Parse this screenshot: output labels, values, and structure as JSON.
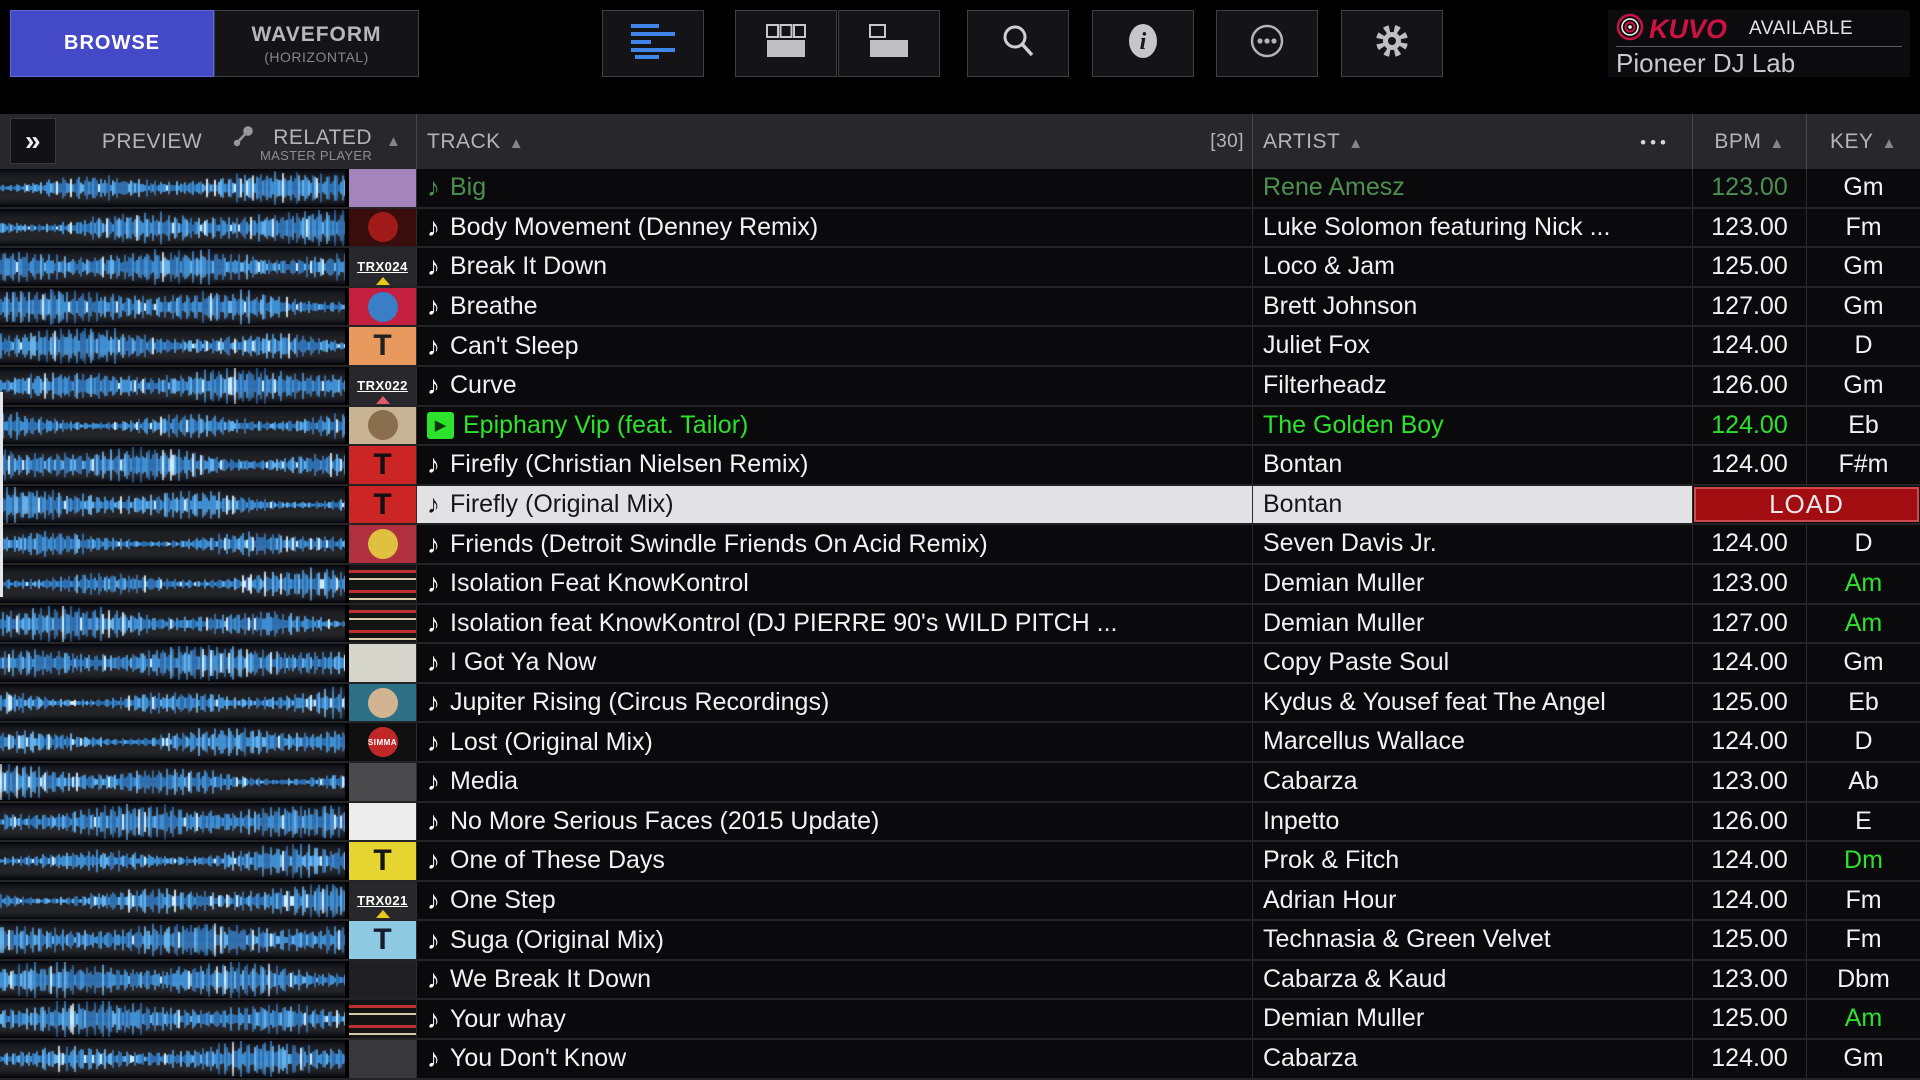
{
  "toolbar": {
    "browse_label": "BROWSE",
    "waveform_label": "WAVEFORM",
    "waveform_sublabel": "(HORIZONTAL)",
    "icons": [
      "list-view",
      "grid-3-view",
      "split-view",
      "search",
      "info",
      "more-options",
      "settings"
    ],
    "kuvo": {
      "brand": "KUVO",
      "status": "AVAILABLE",
      "device": "Pioneer DJ Lab",
      "brand_color": "#cc1244"
    }
  },
  "header": {
    "preview": "PREVIEW",
    "related": "RELATED",
    "related_sub": "MASTER PLAYER",
    "track": "TRACK",
    "track_count": "[30]",
    "artist": "ARTIST",
    "more": "•••",
    "bpm": "BPM",
    "key": "KEY"
  },
  "colors": {
    "accent_blue": "#4449c8",
    "playing_green": "#2ce22c",
    "related_green": "#4d8f50",
    "selected_row": "#e2e2e4",
    "load_red": "#a20d12",
    "waveform_blue": "#2f86d0"
  },
  "load_label": "LOAD",
  "tracks": [
    {
      "title": "Big",
      "artist": "Rene Amesz",
      "bpm": "123.00",
      "key": "Gm",
      "icon": "note",
      "state": "dim",
      "key_color": "white",
      "art": {
        "style": "plain",
        "bg": "#a583bb"
      }
    },
    {
      "title": "Body Movement (Denney Remix)",
      "artist": "Luke Solomon featuring Nick ...",
      "bpm": "123.00",
      "key": "Fm",
      "icon": "note",
      "state": "normal",
      "key_color": "white",
      "art": {
        "style": "circle",
        "bg": "#3a0d0d",
        "fg": "#a11a1a"
      }
    },
    {
      "title": "Break It Down",
      "artist": "Loco & Jam",
      "bpm": "125.00",
      "key": "Gm",
      "icon": "note",
      "state": "normal",
      "key_color": "white",
      "art": {
        "style": "trx",
        "bg": "#28282c",
        "label": "TRX024",
        "tri": "#e8c818"
      }
    },
    {
      "title": "Breathe",
      "artist": "Brett Johnson",
      "bpm": "127.00",
      "key": "Gm",
      "icon": "note",
      "state": "normal",
      "key_color": "white",
      "art": {
        "style": "circle",
        "bg": "#c41f3e",
        "fg": "#3a7ec8"
      }
    },
    {
      "title": "Can't Sleep",
      "artist": "Juliet Fox",
      "bpm": "124.00",
      "key": "D",
      "icon": "note",
      "state": "normal",
      "key_color": "white",
      "art": {
        "style": "tee",
        "bg": "#e89a5e",
        "fg": "#222222"
      }
    },
    {
      "title": "Curve",
      "artist": "Filterheadz",
      "bpm": "126.00",
      "key": "Gm",
      "icon": "note",
      "state": "normal",
      "key_color": "white",
      "art": {
        "style": "trx",
        "bg": "#28282c",
        "label": "TRX022",
        "tri": "#e05a6a"
      }
    },
    {
      "title": "Epiphany Vip (feat. Tailor)",
      "artist": "The Golden Boy",
      "bpm": "124.00",
      "key": "Eb",
      "icon": "play",
      "state": "bright",
      "key_color": "white",
      "art": {
        "style": "circle",
        "bg": "#c8b394",
        "fg": "#8a6f4e"
      }
    },
    {
      "title": "Firefly (Christian Nielsen Remix)",
      "artist": "Bontan",
      "bpm": "124.00",
      "key": "F#m",
      "icon": "note",
      "state": "normal",
      "key_color": "white",
      "art": {
        "style": "tee",
        "bg": "#cc2525",
        "fg": "#111111"
      }
    },
    {
      "title": "Firefly (Original Mix)",
      "artist": "Bontan",
      "bpm": "",
      "key": "",
      "icon": "note",
      "state": "selected",
      "key_color": "white",
      "art": {
        "style": "tee",
        "bg": "#cc2525",
        "fg": "#111111"
      }
    },
    {
      "title": "Friends (Detroit Swindle Friends On Acid Remix)",
      "artist": "Seven Davis Jr.",
      "bpm": "124.00",
      "key": "D",
      "icon": "note",
      "state": "normal",
      "key_color": "white",
      "art": {
        "style": "circle",
        "bg": "#b03040",
        "fg": "#e0c040"
      }
    },
    {
      "title": "Isolation Feat KnowKontrol",
      "artist": "Demian Muller",
      "bpm": "123.00",
      "key": "Am",
      "icon": "note",
      "state": "normal",
      "key_color": "green",
      "art": {
        "style": "stripes",
        "bg": "#141414",
        "s1": "#c03030",
        "s2": "#d8c8a8"
      }
    },
    {
      "title": "Isolation feat KnowKontrol (DJ PIERRE 90's WILD PITCH ...",
      "artist": "Demian Muller",
      "bpm": "127.00",
      "key": "Am",
      "icon": "note",
      "state": "normal",
      "key_color": "green",
      "art": {
        "style": "stripes",
        "bg": "#141414",
        "s1": "#c03030",
        "s2": "#d8c8a8"
      }
    },
    {
      "title": "I Got Ya Now",
      "artist": "Copy Paste Soul",
      "bpm": "124.00",
      "key": "Gm",
      "icon": "note",
      "state": "normal",
      "key_color": "white",
      "art": {
        "style": "plain",
        "bg": "#d6d6cc"
      }
    },
    {
      "title": "Jupiter Rising (Circus Recordings)",
      "artist": "Kydus & Yousef feat The Angel",
      "bpm": "125.00",
      "key": "Eb",
      "icon": "note",
      "state": "normal",
      "key_color": "white",
      "art": {
        "style": "circle",
        "bg": "#2e7186",
        "fg": "#d2b493"
      }
    },
    {
      "title": "Lost (Original Mix)",
      "artist": "Marcellus Wallace",
      "bpm": "124.00",
      "key": "D",
      "icon": "note",
      "state": "normal",
      "key_color": "white",
      "art": {
        "style": "circle",
        "bg": "#101010",
        "fg": "#c02828",
        "label": "SIMMA"
      }
    },
    {
      "title": "Media",
      "artist": "Cabarza",
      "bpm": "123.00",
      "key": "Ab",
      "icon": "note",
      "state": "normal",
      "key_color": "white",
      "art": {
        "style": "plain",
        "bg": "#4a4a4c"
      }
    },
    {
      "title": "No More Serious Faces (2015 Update)",
      "artist": "Inpetto",
      "bpm": "126.00",
      "key": "E",
      "icon": "note",
      "state": "normal",
      "key_color": "white",
      "art": {
        "style": "plain",
        "bg": "#ededed"
      }
    },
    {
      "title": "One of These Days",
      "artist": "Prok & Fitch",
      "bpm": "124.00",
      "key": "Dm",
      "icon": "note",
      "state": "normal",
      "key_color": "green",
      "art": {
        "style": "tee",
        "bg": "#e6d430",
        "fg": "#151515"
      }
    },
    {
      "title": "One Step",
      "artist": "Adrian Hour",
      "bpm": "124.00",
      "key": "Fm",
      "icon": "note",
      "state": "normal",
      "key_color": "white",
      "art": {
        "style": "trx",
        "bg": "#28282c",
        "label": "TRX021",
        "tri": "#e8c818"
      }
    },
    {
      "title": "Suga (Original Mix)",
      "artist": "Technasia & Green Velvet",
      "bpm": "125.00",
      "key": "Fm",
      "icon": "note",
      "state": "normal",
      "key_color": "white",
      "art": {
        "style": "tee",
        "bg": "#8ecbe2",
        "fg": "#1a1a2e"
      }
    },
    {
      "title": "We Break It Down",
      "artist": "Cabarza & Kaud",
      "bpm": "123.00",
      "key": "Dbm",
      "icon": "note",
      "state": "normal",
      "key_color": "white",
      "art": {
        "style": "plain",
        "bg": "#202024"
      }
    },
    {
      "title": "Your whay",
      "artist": "Demian Muller",
      "bpm": "125.00",
      "key": "Am",
      "icon": "note",
      "state": "normal",
      "key_color": "green",
      "art": {
        "style": "stripes",
        "bg": "#141414",
        "s1": "#c03030",
        "s2": "#d8c8a8"
      }
    },
    {
      "title": "You Don't Know",
      "artist": "Cabarza",
      "bpm": "124.00",
      "key": "Gm",
      "icon": "note",
      "state": "normal",
      "key_color": "white",
      "art": {
        "style": "plain",
        "bg": "#38383c"
      }
    }
  ]
}
